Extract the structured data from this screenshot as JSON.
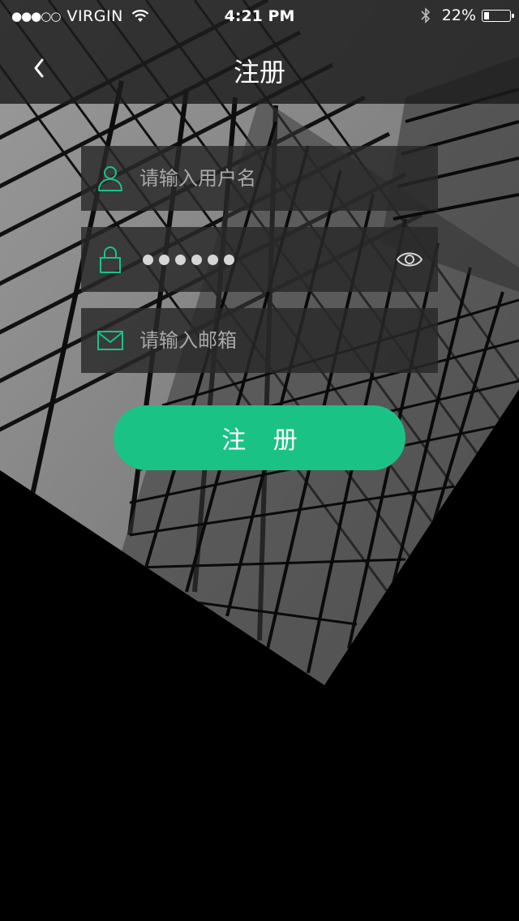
{
  "status_bar": {
    "signal": "●●●○○",
    "carrier": "VIRGIN",
    "time": "4:21 PM",
    "battery_percent": "22%",
    "battery_level": 0.22
  },
  "nav": {
    "title": "注册",
    "back_icon": "chevron-left-icon"
  },
  "form": {
    "username": {
      "placeholder": "请输入用户名",
      "icon": "user-icon"
    },
    "password": {
      "masked_length": 6,
      "icon": "lock-icon",
      "toggle_icon": "eye-icon"
    },
    "email": {
      "placeholder": "请输入邮箱",
      "icon": "mail-icon"
    },
    "submit_label": "注 册"
  },
  "colors": {
    "accent": "#1bc286",
    "field_bg": "#282828",
    "placeholder": "#a9a9a9"
  }
}
